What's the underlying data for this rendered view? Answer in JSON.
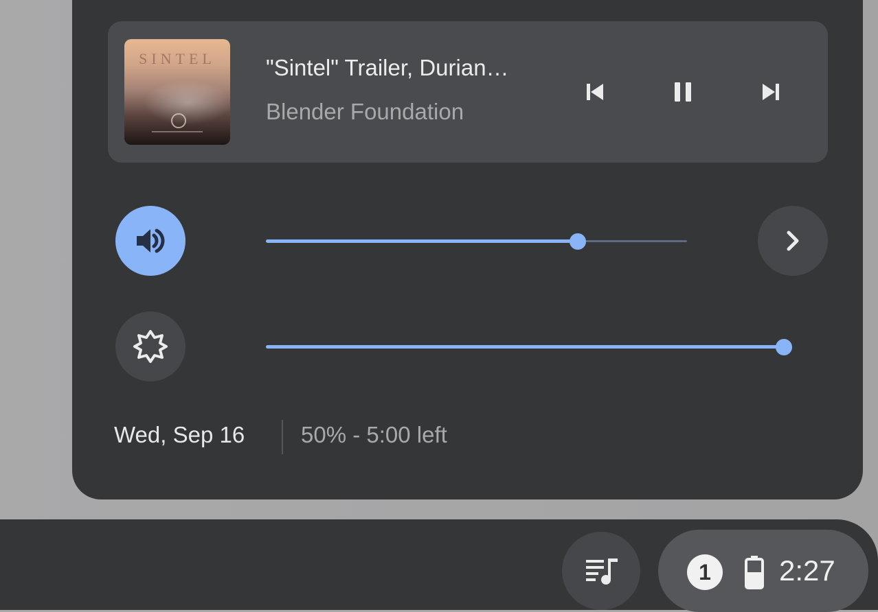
{
  "colors": {
    "accent": "#8ab4f8",
    "panel_background": "#353638",
    "card_background": "#4a4b4e",
    "primary_text": "#ececec",
    "secondary_text": "#a8a9ab"
  },
  "media": {
    "title": "\"Sintel\" Trailer, Durian…",
    "artist": "Blender Foundation",
    "artwork_text": "SINTEL",
    "controls": [
      {
        "name": "previous-track",
        "icon": "skip-previous-icon"
      },
      {
        "name": "pause",
        "icon": "pause-icon"
      },
      {
        "name": "next-track",
        "icon": "skip-next-icon"
      }
    ]
  },
  "sliders": {
    "volume": {
      "icon": "volume-icon",
      "level_fraction": 0.74,
      "active": true
    },
    "brightness": {
      "icon": "brightness-icon",
      "level_fraction": 1.0
    }
  },
  "audio_settings_icon": "chevron-right-icon",
  "status": {
    "date": "Wed, Sep 16",
    "battery": "50% - 5:00 left"
  },
  "shelf": {
    "media_icon": "playlist-music-icon",
    "notification_count": "1",
    "battery_icon": "battery-icon",
    "time": "2:27"
  }
}
